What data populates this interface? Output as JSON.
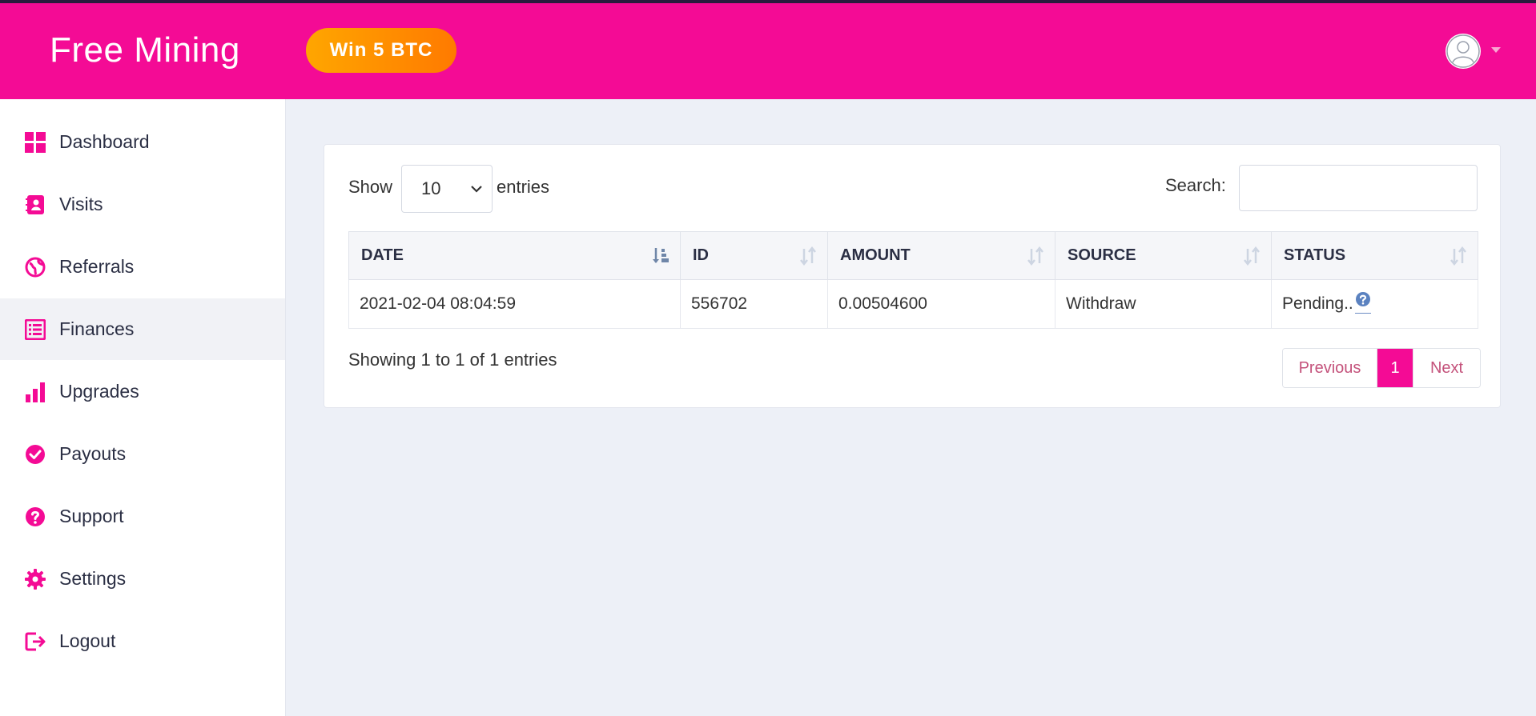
{
  "header": {
    "brand": "Free Mining",
    "promo_label": "Win 5 BTC",
    "accent_color": "#f40b95"
  },
  "sidebar": {
    "items": [
      {
        "label": "Dashboard",
        "icon": "grid-icon"
      },
      {
        "label": "Visits",
        "icon": "contact-book-icon"
      },
      {
        "label": "Referrals",
        "icon": "globe-icon"
      },
      {
        "label": "Finances",
        "icon": "list-icon",
        "active": true
      },
      {
        "label": "Upgrades",
        "icon": "bar-chart-icon"
      },
      {
        "label": "Payouts",
        "icon": "check-circle-icon"
      },
      {
        "label": "Support",
        "icon": "question-circle-icon"
      },
      {
        "label": "Settings",
        "icon": "gear-icon"
      },
      {
        "label": "Logout",
        "icon": "logout-icon"
      }
    ]
  },
  "table_controls": {
    "show_label": "Show",
    "page_length": "10",
    "entries_label": "entries",
    "search_label": "Search:",
    "search_value": ""
  },
  "table": {
    "columns": [
      "DATE",
      "ID",
      "AMOUNT",
      "SOURCE",
      "STATUS"
    ],
    "rows": [
      {
        "date": "2021-02-04 08:04:59",
        "id": "556702",
        "amount": "0.00504600",
        "source": "Withdraw",
        "status": "Pending.."
      }
    ]
  },
  "footer": {
    "info": "Showing 1 to 1 of 1 entries",
    "previous": "Previous",
    "current_page": "1",
    "next": "Next"
  }
}
